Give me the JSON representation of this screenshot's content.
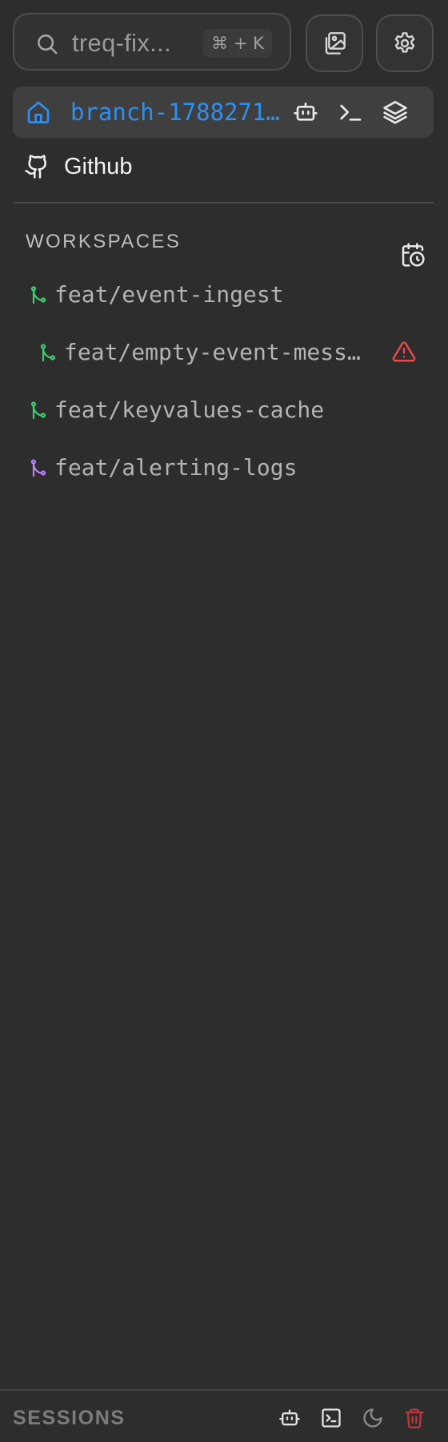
{
  "search": {
    "value": "treq-fix...",
    "shortcut": "⌘ + K",
    "icon": "search-icon"
  },
  "toolbar": {
    "gallery_icon": "image-gallery-icon",
    "settings_icon": "gear-icon"
  },
  "branch_bar": {
    "name": "branch-1788271…",
    "name_color": "#2f8ff0",
    "icons": [
      "home-icon",
      "bot-icon",
      "terminal-icon",
      "layers-icon"
    ]
  },
  "github": {
    "label": "Github",
    "icon": "github-icon"
  },
  "workspaces": {
    "header": "WORKSPACES",
    "calendar_icon": "calendar-clock-icon",
    "items": [
      {
        "label": "feat/event-ingest",
        "color": "#3ecf6e",
        "nested": false
      },
      {
        "label": "feat/empty-event-mess…",
        "color": "#3ecf6e",
        "nested": true,
        "warning": true,
        "warning_color": "#e5484d"
      },
      {
        "label": "feat/keyvalues-cache",
        "color": "#3ecf6e",
        "nested": false
      },
      {
        "label": "feat/alerting-logs",
        "color": "#b983ff",
        "nested": false
      }
    ]
  },
  "sessions": {
    "label": "SESSIONS",
    "icons": [
      "bot-icon",
      "terminal-square-icon",
      "moon-icon",
      "trash-icon"
    ],
    "trash_color": "#b8393d"
  }
}
